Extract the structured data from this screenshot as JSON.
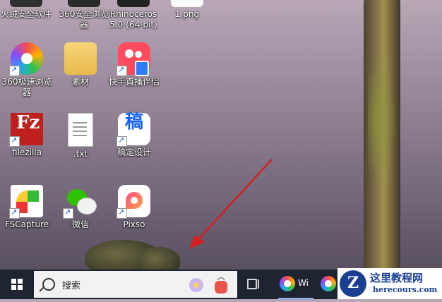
{
  "desktop": {
    "top_row": [
      {
        "label": "火绒安全软件"
      },
      {
        "label": "360安全浏览\n器"
      },
      {
        "label": "Rhinoceros\n5.0 (64-bit)"
      },
      {
        "label": "1.png"
      }
    ],
    "icons": [
      {
        "label": "360极速浏览\n器",
        "icon": "360-speed-browser-icon"
      },
      {
        "label": "素材",
        "icon": "folder-icon"
      },
      {
        "label": "快手直播伴侣",
        "icon": "kuaishou-live-icon"
      },
      {
        "label": "filezilla",
        "icon": "filezilla-icon"
      },
      {
        "label": ".txt",
        "icon": "text-file-icon"
      },
      {
        "label": "稿定设计",
        "icon": "gaoding-design-icon"
      },
      {
        "label": "FSCapture",
        "icon": "fscapture-icon"
      },
      {
        "label": "微信",
        "icon": "wechat-icon"
      },
      {
        "label": "Pixso",
        "icon": "pixso-icon"
      }
    ],
    "colors": {
      "arrow": "#d42020"
    }
  },
  "taskbar": {
    "search_placeholder": "搜索",
    "apps": [
      {
        "label": "Wi",
        "icon": "360-browser-icon"
      },
      {
        "label": "",
        "icon": "360-browser-icon"
      }
    ]
  },
  "watermark": {
    "logo_letter": "Z",
    "title": "这里教程网",
    "url": "herecours.com"
  }
}
